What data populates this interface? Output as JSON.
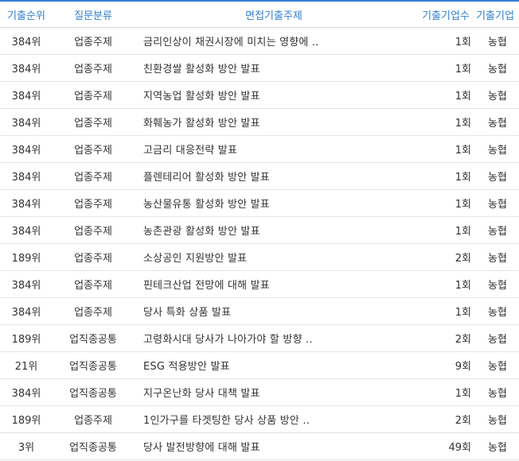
{
  "header": {
    "rank": "기출순위",
    "category": "질문분류",
    "topic": "면접기출주제",
    "count": "기출기업수",
    "company": "기출기업"
  },
  "rows": [
    {
      "rank": "384위",
      "category": "업종주제",
      "topic": "금리인상이 채권시장에 미치는 영향에 ..",
      "count": "1회",
      "company": "농협"
    },
    {
      "rank": "384위",
      "category": "업종주제",
      "topic": "친환경쌀 활성화 방안 발표",
      "count": "1회",
      "company": "농협"
    },
    {
      "rank": "384위",
      "category": "업종주제",
      "topic": "지역농업 활성화 방안 발표",
      "count": "1회",
      "company": "농협"
    },
    {
      "rank": "384위",
      "category": "업종주제",
      "topic": "화훼농가 활성화 방안 발표",
      "count": "1회",
      "company": "농협"
    },
    {
      "rank": "384위",
      "category": "업종주제",
      "topic": "고금리 대응전략 발표",
      "count": "1회",
      "company": "농협"
    },
    {
      "rank": "384위",
      "category": "업종주제",
      "topic": "플렌테리어 활성화 방안 발표",
      "count": "1회",
      "company": "농협"
    },
    {
      "rank": "384위",
      "category": "업종주제",
      "topic": "농산물유통 활성화 방안 발표",
      "count": "1회",
      "company": "농협"
    },
    {
      "rank": "384위",
      "category": "업종주제",
      "topic": "농촌관광 활성화 방안 발표",
      "count": "1회",
      "company": "농협"
    },
    {
      "rank": "189위",
      "category": "업종주제",
      "topic": "소상공인 지원방안 발표",
      "count": "2회",
      "company": "농협"
    },
    {
      "rank": "384위",
      "category": "업종주제",
      "topic": "핀테크산업 전망에 대해 발표",
      "count": "1회",
      "company": "농협"
    },
    {
      "rank": "384위",
      "category": "업종주제",
      "topic": "당사 특화 상품 발표",
      "count": "1회",
      "company": "농협"
    },
    {
      "rank": "189위",
      "category": "업직종공통",
      "topic": "고령화시대 당사가 나아가야 할 방향 ..",
      "count": "2회",
      "company": "농협"
    },
    {
      "rank": "21위",
      "category": "업직종공통",
      "topic": "ESG 적용방안 발표",
      "count": "9회",
      "company": "농협"
    },
    {
      "rank": "384위",
      "category": "업직종공통",
      "topic": "지구온난화 당사 대책 발표",
      "count": "1회",
      "company": "농협"
    },
    {
      "rank": "189위",
      "category": "업종주제",
      "topic": "1인가구를 타겟팅한 당사 상품 방안 ..",
      "count": "2회",
      "company": "농협"
    },
    {
      "rank": "3위",
      "category": "업직종공통",
      "topic": "당사 발전방향에 대해 발표",
      "count": "49회",
      "company": "농협"
    }
  ]
}
